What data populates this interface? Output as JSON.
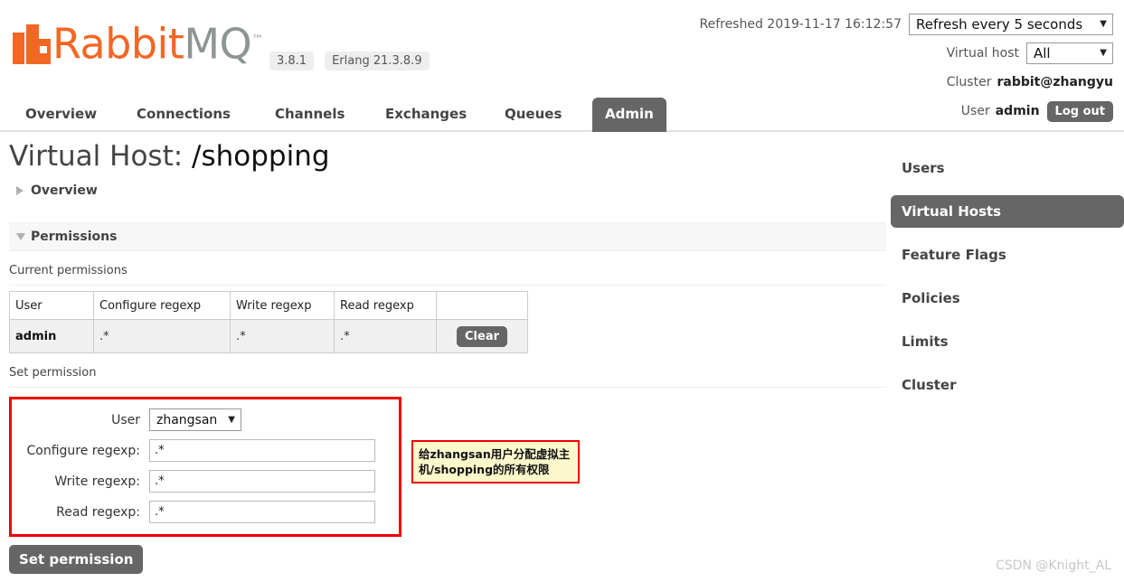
{
  "header": {
    "logo": {
      "rabbit_text": "Rabbit",
      "mq_text": "MQ",
      "tm_text": "™",
      "mark_icon": "rabbitmq-logo-icon",
      "brand_color": "#f26724",
      "mq_color": "#8e9694"
    },
    "version_badge": "3.8.1",
    "erlang_badge": "Erlang 21.3.8.9",
    "refreshed_text": "Refreshed 2019-11-17 16:12:57",
    "refresh_select_value": "Refresh every 5 seconds",
    "virtual_host_label": "Virtual host",
    "virtual_host_select_value": "All",
    "cluster_label": "Cluster",
    "cluster_value": "rabbit@zhangyu",
    "user_label": "User",
    "user_value": "admin",
    "logout_label": "Log out",
    "caret": "▼"
  },
  "tabs": [
    {
      "label": "Overview",
      "active": false
    },
    {
      "label": "Connections",
      "active": false
    },
    {
      "label": "Channels",
      "active": false
    },
    {
      "label": "Exchanges",
      "active": false
    },
    {
      "label": "Queues",
      "active": false
    },
    {
      "label": "Admin",
      "active": true
    }
  ],
  "main": {
    "title_prefix": "Virtual Host: ",
    "vhost_name": "/shopping",
    "overview_section": "Overview",
    "permissions_section": "Permissions",
    "current_permissions_label": "Current permissions",
    "set_permission_label": "Set permission",
    "table": {
      "columns": [
        "User",
        "Configure regexp",
        "Write regexp",
        "Read regexp",
        ""
      ],
      "rows": [
        {
          "user": "admin",
          "configure": ".*",
          "write": ".*",
          "read": ".*",
          "action": "Clear"
        }
      ]
    },
    "form": {
      "user_label": "User",
      "user_value": "zhangsan",
      "configure_label": "Configure regexp:",
      "configure_value": ".*",
      "write_label": "Write regexp:",
      "write_value": ".*",
      "read_label": "Read regexp:",
      "read_value": ".*",
      "submit_label": "Set permission",
      "highlight_color": "#ee0000"
    },
    "annotation": "给zhangsan用户分配虚拟主机/shopping的所有权限"
  },
  "sidebar": {
    "items": [
      {
        "label": "Users",
        "active": false
      },
      {
        "label": "Virtual Hosts",
        "active": true
      },
      {
        "label": "Feature Flags",
        "active": false
      },
      {
        "label": "Policies",
        "active": false
      },
      {
        "label": "Limits",
        "active": false
      },
      {
        "label": "Cluster",
        "active": false
      }
    ]
  },
  "watermark": "CSDN @Knight_AL"
}
